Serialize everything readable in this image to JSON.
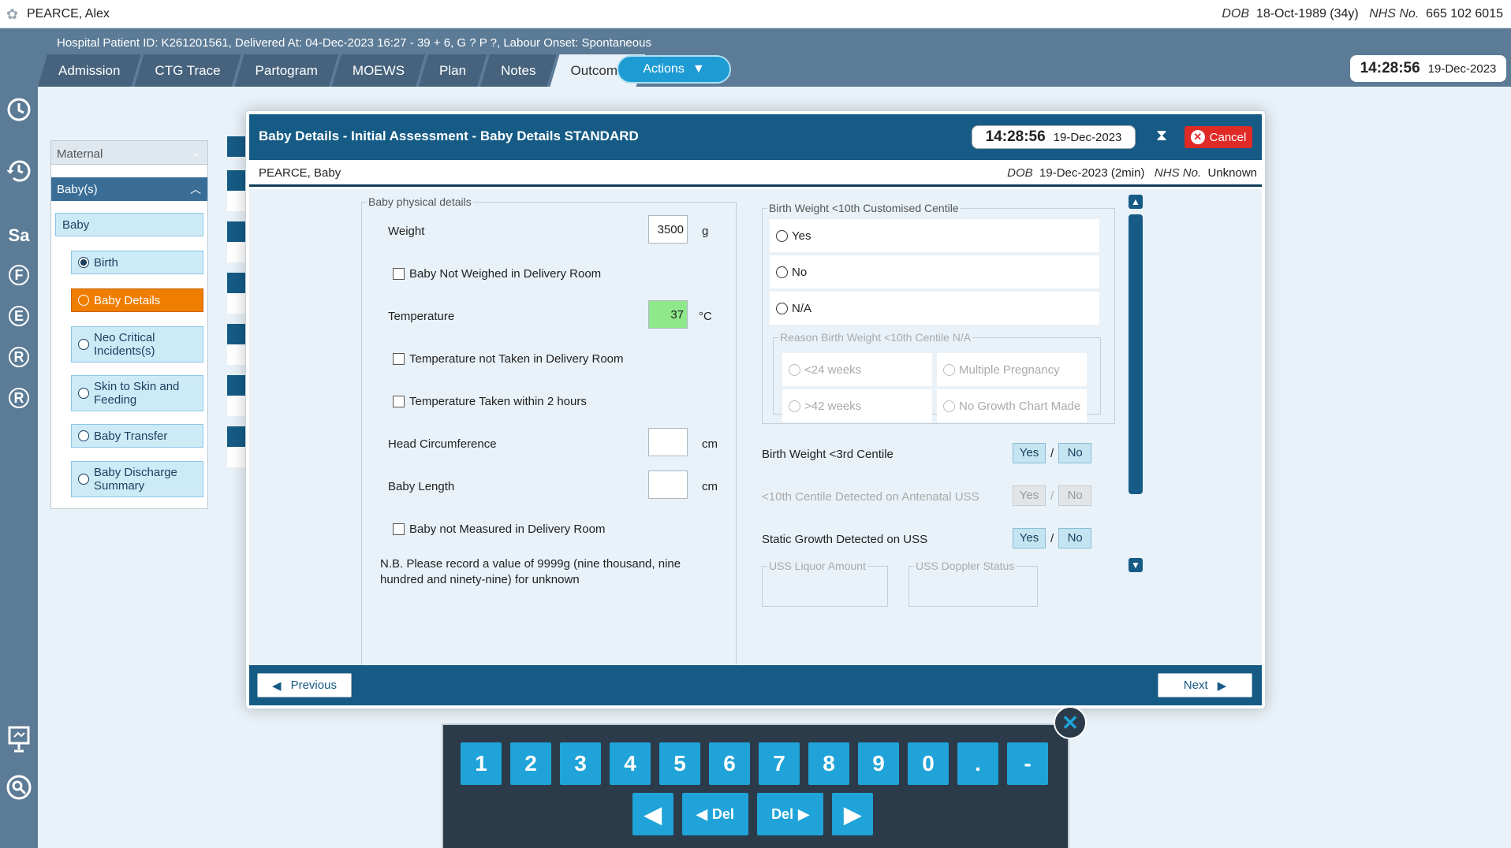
{
  "patient": {
    "name": "PEARCE, Alex",
    "dob_label": "DOB",
    "dob": "18-Oct-1989 (34y)",
    "nhs_label": "NHS No.",
    "nhs": "665 102 6015"
  },
  "header": {
    "info": "Hospital Patient ID: K261201561, Delivered At: 04-Dec-2023 16:27 - 39 + 6, G ? P ?,   Labour Onset: Spontaneous",
    "tabs": [
      "Admission",
      "CTG Trace",
      "Partogram",
      "MOEWS",
      "Plan",
      "Notes",
      "Outcome"
    ],
    "actions_label": "Actions",
    "clock_time": "14:28:56",
    "clock_date": "19-Dec-2023"
  },
  "rail": {
    "items": [
      "Sa",
      "F",
      "E",
      "R",
      "R"
    ]
  },
  "nav": {
    "select_label": "Maternal",
    "section": "Baby(s)",
    "baby": "Baby",
    "items": [
      "Birth",
      "Baby Details",
      "Neo Critical Incidents(s)",
      "Skin to Skin and Feeding",
      "Baby Transfer",
      "Baby Discharge Summary"
    ]
  },
  "dialog": {
    "title": "Baby Details - Initial Assessment - Baby Details STANDARD",
    "clock_time": "14:28:56",
    "clock_date": "19-Dec-2023",
    "cancel_label": "Cancel",
    "baby_name": "PEARCE, Baby",
    "baby_dob_label": "DOB",
    "baby_dob": "19-Dec-2023 (2min)",
    "baby_nhs_label": "NHS No.",
    "baby_nhs": "Unknown",
    "physical": {
      "legend": "Baby physical details",
      "weight_label": "Weight",
      "weight_value": "3500",
      "weight_unit": "g",
      "not_weighed": "Baby Not Weighed in Delivery Room",
      "temp_label": "Temperature",
      "temp_value": "37",
      "temp_unit": "°C",
      "temp_not_taken": "Temperature not Taken in Delivery Room",
      "temp_2h": "Temperature Taken within 2 hours",
      "head_label": "Head Circumference",
      "head_unit": "cm",
      "length_label": "Baby Length",
      "length_unit": "cm",
      "not_measured": "Baby not Measured in Delivery Room",
      "note": "N.B. Please record a value of 9999g (nine thousand, nine hundred and ninety-nine) for unknown"
    },
    "centile": {
      "legend": "Birth Weight <10th Customised Centile",
      "options": [
        "Yes",
        "No",
        "N/A"
      ],
      "reason_legend": "Reason Birth Weight <10th Centile N/A",
      "reasons": [
        "<24 weeks",
        "Multiple Pregnancy",
        ">42 weeks",
        "No Growth Chart Made"
      ]
    },
    "yn_rows": [
      {
        "label": "Birth Weight <3rd Centile",
        "yes": "Yes",
        "sep": "/",
        "no": "No"
      },
      {
        "label": "<10th Centile Detected on Antenatal USS",
        "yes": "Yes",
        "sep": "/",
        "no": "No"
      },
      {
        "label": "Static Growth Detected on USS",
        "yes": "Yes",
        "sep": "/",
        "no": "No"
      }
    ],
    "uss_liquor": "USS Liquor Amount",
    "uss_doppler": "USS Doppler Status",
    "prev_label": "Previous",
    "next_label": "Next"
  },
  "keypad": {
    "keys": [
      "1",
      "2",
      "3",
      "4",
      "5",
      "6",
      "7",
      "8",
      "9",
      "0",
      ".",
      "-"
    ],
    "del_label": "Del"
  }
}
